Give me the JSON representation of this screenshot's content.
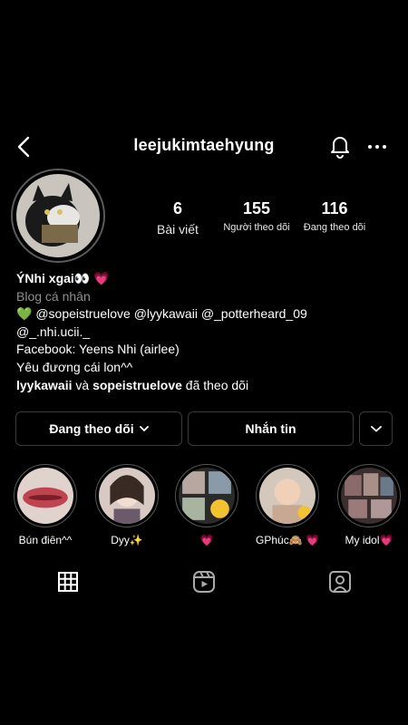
{
  "header": {
    "username": "leejukimtaehyung",
    "back_icon": "chevron-left-icon",
    "bell_icon": "bell-icon",
    "more_icon": "more-horizontal-icon"
  },
  "stats": {
    "posts": {
      "value": "6",
      "label": "Bài viết"
    },
    "followers": {
      "value": "155",
      "label": "Người theo dõi"
    },
    "following": {
      "value": "116",
      "label": "Đang theo dõi"
    }
  },
  "bio": {
    "name": "ÝNhi xgai👀 💗",
    "category": "Blog cá nhân",
    "line1": "💚 @sopeistruelove @lyykawaii @_potterheard_09",
    "line2": "@_.nhi.ucii._",
    "line3": "Facebook: Yeens Nhi (airlee)",
    "line4": "Yêu đương cái lon^^",
    "followed_by_user1": "lyykawaii",
    "followed_by_conj": " và ",
    "followed_by_user2": "sopeistruelove",
    "followed_by_suffix": " đã theo dõi"
  },
  "actions": {
    "following_label": "Đang theo dõi",
    "message_label": "Nhắn tin"
  },
  "highlights": [
    {
      "caption": "Bún điên^^"
    },
    {
      "caption": "Dyy✨"
    },
    {
      "caption": "💗"
    },
    {
      "caption": "GPhúc🙈 💗"
    },
    {
      "caption": "My idol💗"
    }
  ],
  "tabs": [
    {
      "icon": "grid-icon"
    },
    {
      "icon": "reels-icon"
    },
    {
      "icon": "tagged-icon"
    }
  ],
  "colors": {
    "background": "#000000",
    "text": "#ffffff",
    "secondary_text": "#8e8e8e",
    "border": "#3a3a3a"
  }
}
